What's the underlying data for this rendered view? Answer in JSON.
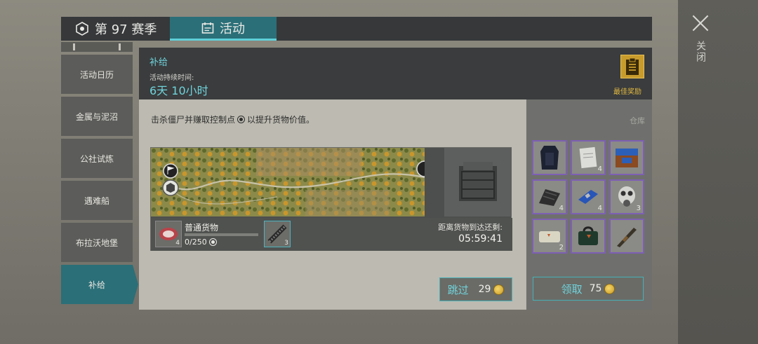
{
  "top_tabs": {
    "season_label": "第 97 赛季",
    "activity_label": "活动"
  },
  "close": {
    "label": "关闭"
  },
  "menu": {
    "items": [
      {
        "label": "活动日历"
      },
      {
        "label": "金属与泥沼"
      },
      {
        "label": "公社试炼"
      },
      {
        "label": "遇难船"
      },
      {
        "label": "布拉沃地堡"
      },
      {
        "label": "补给"
      }
    ],
    "active_index": 5
  },
  "event": {
    "title": "补给",
    "duration_label": "活动持续时间:",
    "duration_value": "6天 10小时",
    "best_reward_label": "最佳奖励",
    "description_before": "击杀僵尸并赚取控制点",
    "description_after": "以提升货物价值。"
  },
  "cargo": {
    "name": "普通货物",
    "meat_count": "4",
    "progress_text": "0/250",
    "progress_fraction": 0.0,
    "chain_count": "3",
    "arrive_label": "距离货物到达还剩:",
    "arrive_time": "05:59:41"
  },
  "skip": {
    "label": "跳过",
    "cost": "29"
  },
  "storage": {
    "title": "仓库",
    "items": [
      {
        "icon": "armor-vest-icon",
        "count": ""
      },
      {
        "icon": "paper-note-icon",
        "count": "4"
      },
      {
        "icon": "blue-crate-icon",
        "count": ""
      },
      {
        "icon": "metal-sheet-icon",
        "count": "4"
      },
      {
        "icon": "circuit-board-icon",
        "count": "4"
      },
      {
        "icon": "gas-mask-icon",
        "count": "3"
      },
      {
        "icon": "ammo-box-icon",
        "count": "2"
      },
      {
        "icon": "military-bag-icon",
        "count": ""
      },
      {
        "icon": "rifle-icon",
        "count": ""
      }
    ]
  },
  "claim": {
    "label": "领取",
    "cost": "75"
  },
  "colors": {
    "accent_teal": "#6fd3dc",
    "tab_active": "#2b6f78",
    "gold": "#c89b2d",
    "rarity_purple": "#7d5fb4"
  }
}
